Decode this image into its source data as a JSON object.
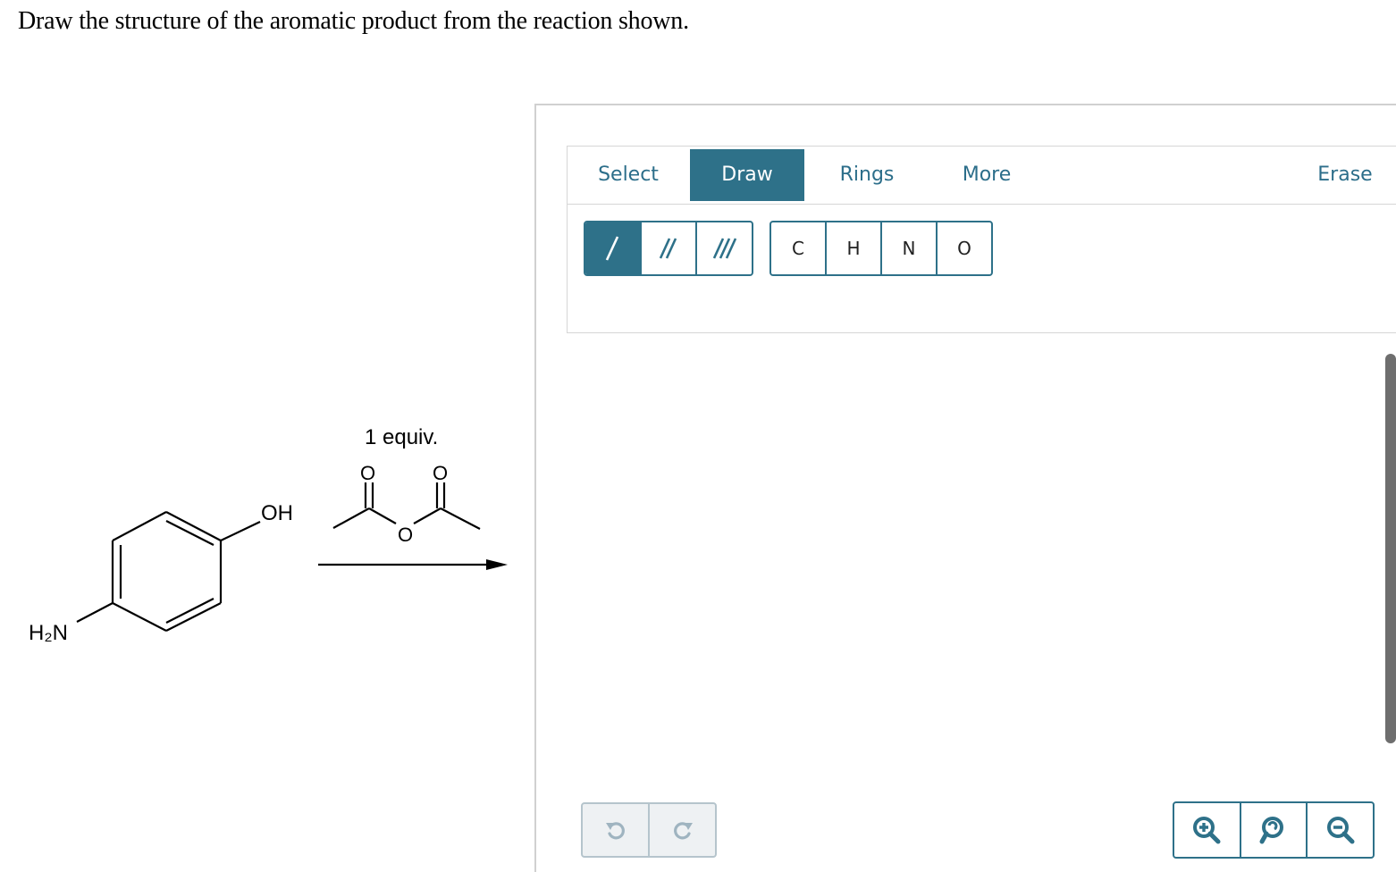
{
  "question": {
    "text": "Draw the structure of the aromatic product from the reaction shown."
  },
  "reaction": {
    "reagent_equiv": "1 equiv.",
    "substrate_oh_label": "OH",
    "substrate_amine_label": "H₂N",
    "carbonyl_o_label": "O",
    "bridging_o_label": "O"
  },
  "toolbar": {
    "tabs": [
      {
        "label": "Select",
        "active": false
      },
      {
        "label": "Draw",
        "active": true
      },
      {
        "label": "Rings",
        "active": false
      },
      {
        "label": "More",
        "active": false
      },
      {
        "label": "Erase",
        "active": false
      }
    ],
    "bonds": [
      "single-bond",
      "double-bond",
      "triple-bond"
    ],
    "atoms": [
      "C",
      "H",
      "N",
      "O"
    ]
  },
  "history": {
    "icons": [
      "undo-icon",
      "redo-icon"
    ]
  },
  "zoom": {
    "icons": [
      "zoom-in-icon",
      "zoom-reset-icon",
      "zoom-out-icon"
    ]
  },
  "colors": {
    "accent": "#2e7189",
    "tab_text": "#2c6e8a",
    "disabled_bg": "#eef1f3"
  }
}
